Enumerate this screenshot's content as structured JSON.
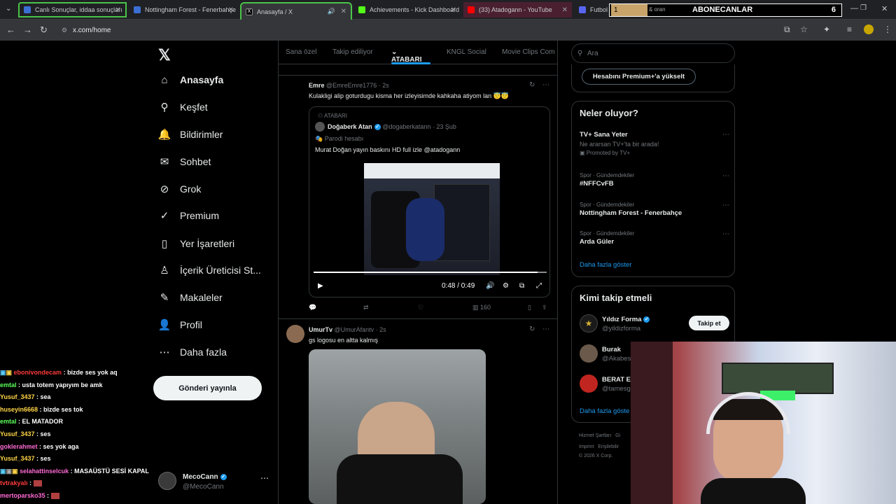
{
  "browser": {
    "tabs": [
      {
        "label": "Canlı Sonuçlar, iddaa sonuçları",
        "color": "#3b6fd4"
      },
      {
        "label": "Nottingham Forest - Fenerbahçe",
        "color": "#3b6fd4"
      },
      {
        "label": "Anasayfa / X",
        "color": "#000000"
      },
      {
        "label": "Achievements - Kick Dashboard",
        "color": "#53fc18"
      },
      {
        "label": "(33) Atadogann - YouTube",
        "color": "#ff0000"
      },
      {
        "label": "Futbol",
        "color": "#5865f2"
      }
    ],
    "url": "x.com/home",
    "overlay": {
      "left": "1",
      "mid": "& oran",
      "title": "ABONECANLAR",
      "count": "6"
    }
  },
  "sidebar": {
    "items": [
      {
        "label": "Anasayfa",
        "icon": "home-icon",
        "glyph": "⌂"
      },
      {
        "label": "Keşfet",
        "icon": "search-icon",
        "glyph": "⚲"
      },
      {
        "label": "Bildirimler",
        "icon": "bell-icon",
        "glyph": "🔔"
      },
      {
        "label": "Sohbet",
        "icon": "mail-icon",
        "glyph": "✉"
      },
      {
        "label": "Grok",
        "icon": "grok-icon",
        "glyph": "⊘"
      },
      {
        "label": "Premium",
        "icon": "premium-icon",
        "glyph": "✓"
      },
      {
        "label": "Yer İşaretleri",
        "icon": "bookmark-icon",
        "glyph": "▯"
      },
      {
        "label": "İçerik Üreticisi St...",
        "icon": "creator-icon",
        "glyph": "♙"
      },
      {
        "label": "Makaleler",
        "icon": "article-icon",
        "glyph": "✎"
      },
      {
        "label": "Profil",
        "icon": "profile-icon",
        "glyph": "👤"
      },
      {
        "label": "Daha fazla",
        "icon": "more-icon",
        "glyph": "⋯"
      }
    ],
    "post_button": "Gönderi yayınla",
    "account": {
      "name": "MecoCann",
      "handle": "@MecoCann"
    }
  },
  "chat": [
    {
      "user": "ebonivondecam",
      "color": "#ff3b3b",
      "text": "bizde ses yok aq"
    },
    {
      "user": "emtal",
      "color": "#5cff5c",
      "text": "usta totem yapıyım be amk"
    },
    {
      "user": "Yusuf_3437",
      "color": "#ffd447",
      "text": "sea"
    },
    {
      "user": "huseyin6668",
      "color": "#ffd447",
      "text": "bizde ses tok"
    },
    {
      "user": "emtal",
      "color": "#5cff5c",
      "text": "EL MATADOR"
    },
    {
      "user": "Yusuf_3437",
      "color": "#ffd447",
      "text": "ses"
    },
    {
      "user": "goklerahmet",
      "color": "#ff6bd5",
      "text": "ses yok aga"
    },
    {
      "user": "Yusuf_3437",
      "color": "#ffd447",
      "text": "ses"
    },
    {
      "user": "selahattinselcuk",
      "color": "#ff6bd5",
      "text": "MASAÜSTÜ SESİ KAPAL"
    },
    {
      "user": "tvtrakyalı",
      "color": "#ff3b3b",
      "text": ""
    },
    {
      "user": "mertoparsko35",
      "color": "#ff6bd5",
      "text": ""
    }
  ],
  "feed": {
    "tabs": [
      "Sana özel",
      "Takip ediliyor",
      "ATABARI",
      "KNGL Social",
      "Movie Clips Com"
    ],
    "tweet1": {
      "name": "Emre",
      "handle": "@EmreEmre1776 · 2s",
      "text": "Kulakligi alip goturdugu kisma her izleyisimde kahkaha atiyom lan 😇😇",
      "quote": {
        "community": "ATABARI",
        "name": "Doğaberk Atan",
        "handle": "@dogaberkatann · 23 Şub",
        "parody": "Parodi hesabı",
        "text": "Murat Doğan yayın baskını HD full izle @atadogann",
        "time": "0:48 / 0:49"
      },
      "views": "160"
    },
    "tweet2": {
      "name": "UmurTv",
      "handle": "@UmurAfantv · 2s",
      "text": "gs logosu en altta kalmış"
    }
  },
  "right": {
    "search_placeholder": "Ara",
    "premium_button": "Hesabını Premium+'a yükselt",
    "trends_title": "Neler oluyor?",
    "trends": [
      {
        "meta": "",
        "title": "TV+ Sana Yeter",
        "sub": "Ne ararsan TV+'ta bir arada!",
        "promo": "Promoted by TV+"
      },
      {
        "meta": "Spor · Gündemdekiler",
        "title": "#NFFCvFB"
      },
      {
        "meta": "Spor · Gündemdekiler",
        "title": "Nottingham Forest - Fenerbahçe"
      },
      {
        "meta": "Spor · Gündemdekiler",
        "title": "Arda Güler"
      }
    ],
    "show_more": "Daha fazla göster",
    "who_title": "Kimi takip etmeli",
    "who": [
      {
        "name": "Yıldız Forma",
        "handle": "@yildizforma",
        "avatar": "#1a1a1a"
      },
      {
        "name": "Burak",
        "handle": "@Akabes",
        "avatar": "#6b5a4b"
      },
      {
        "name": "BERAT E",
        "handle": "@tamesg",
        "avatar": "#c0261f"
      }
    ],
    "follow_label": "Takip et",
    "who_more": "Daha fazla göste",
    "footer": [
      "Hizmet Şartları",
      "Gi",
      "Imprint",
      "Erişilebilir",
      "© 2026 X Corp."
    ]
  }
}
